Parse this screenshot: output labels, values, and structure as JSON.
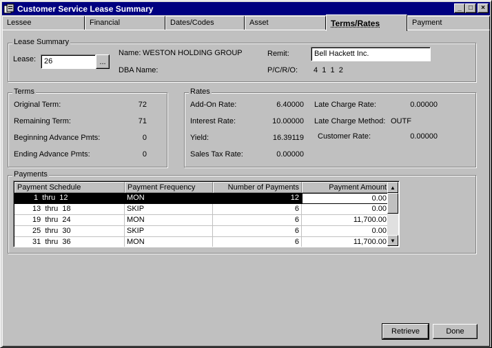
{
  "window": {
    "title": "Customer Service Lease Summary",
    "minimize_glyph": "_",
    "maximize_glyph": "□",
    "close_glyph": "×"
  },
  "tabs": [
    {
      "label": "Lessee"
    },
    {
      "label": "Financial"
    },
    {
      "label": "Dates/Codes"
    },
    {
      "label": "Asset"
    },
    {
      "label": "Terms/Rates",
      "active": true
    },
    {
      "label": "Payment"
    }
  ],
  "lease_summary": {
    "group_title": "Lease Summary",
    "lease_label": "Lease:",
    "lease_value": "26",
    "lookup_button": "...",
    "name_label": "Name:",
    "name_value": "WESTON HOLDING GROUP",
    "dba_label": "DBA Name:",
    "dba_value": "",
    "remit_label": "Remit:",
    "remit_value": "Bell Hackett Inc.",
    "pcro_label": "P/C/R/O:",
    "pcro_value": "4  1  1  2"
  },
  "terms": {
    "group_title": "Terms",
    "original_term_label": "Original Term:",
    "original_term": "72",
    "remaining_term_label": "Remaining Term:",
    "remaining_term": "71",
    "beginning_advance_label": "Beginning Advance Pmts:",
    "beginning_advance": "0",
    "ending_advance_label": "Ending Advance Pmts:",
    "ending_advance": "0"
  },
  "rates": {
    "group_title": "Rates",
    "add_on_rate_label": "Add-On Rate:",
    "add_on_rate": "6.40000",
    "interest_rate_label": "Interest Rate:",
    "interest_rate": "10.00000",
    "yield_label": "Yield:",
    "yield": "16.39119",
    "sales_tax_rate_label": "Sales Tax Rate:",
    "sales_tax_rate": "0.00000",
    "late_charge_rate_label": "Late Charge Rate:",
    "late_charge_rate": "0.00000",
    "late_charge_method_label": "Late Charge Method:",
    "late_charge_method": "OUTF",
    "customer_rate_label": "Customer Rate:",
    "customer_rate": "0.00000"
  },
  "payments": {
    "group_title": "Payments",
    "columns": [
      "Payment Schedule",
      "Payment Frequency",
      "Number of Payments",
      "Payment Amount"
    ],
    "rows": [
      {
        "schedule": "1  thru  12",
        "frequency": "MON",
        "count": "12",
        "amount": "0.00",
        "selected": true
      },
      {
        "schedule": "13  thru  18",
        "frequency": "SKIP",
        "count": "6",
        "amount": "0.00"
      },
      {
        "schedule": "19  thru  24",
        "frequency": "MON",
        "count": "6",
        "amount": "11,700.00"
      },
      {
        "schedule": "25  thru  30",
        "frequency": "SKIP",
        "count": "6",
        "amount": "0.00"
      },
      {
        "schedule": "31  thru  36",
        "frequency": "MON",
        "count": "6",
        "amount": "11,700.00"
      }
    ],
    "scroll_up_glyph": "▲",
    "scroll_down_glyph": "▼"
  },
  "buttons": {
    "retrieve": "Retrieve",
    "done": "Done"
  }
}
